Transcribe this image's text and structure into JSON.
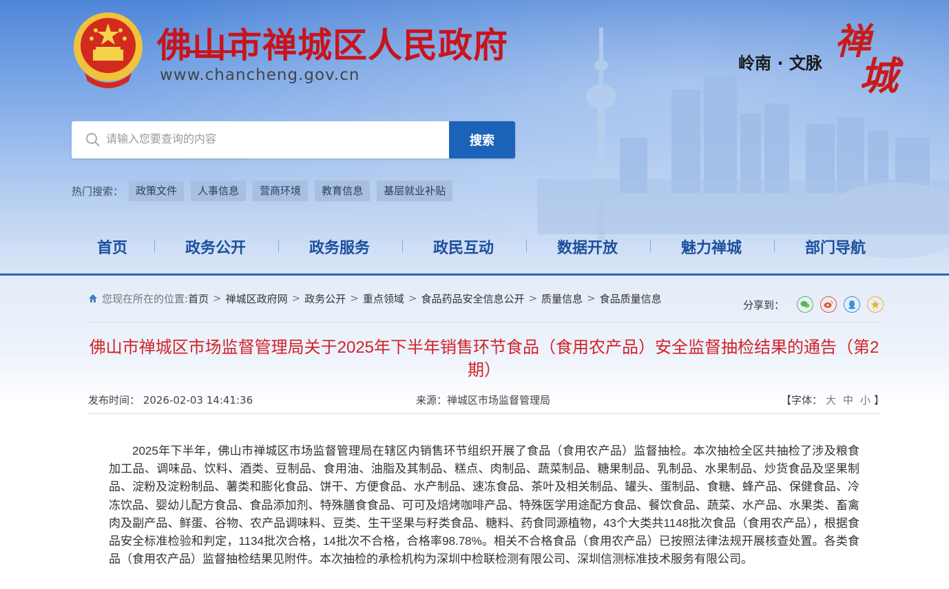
{
  "site": {
    "title": "佛山市禅城区人民政府",
    "url": "www.chancheng.gov.cn",
    "slogan": "岭南 · 文脉",
    "calligraphy": [
      "禅",
      "城"
    ]
  },
  "search": {
    "placeholder": "请输入您要查询的内容",
    "button_label": "搜索",
    "hot_label": "热门搜索：",
    "hot_tags": [
      "政策文件",
      "人事信息",
      "营商环境",
      "教育信息",
      "基层就业补贴"
    ]
  },
  "nav": {
    "items": [
      "首页",
      "政务公开",
      "政务服务",
      "政民互动",
      "数据开放",
      "魅力禅城",
      "部门导航"
    ],
    "active": "政务公开"
  },
  "breadcrumb": {
    "prefix": "您现在所在的位置:",
    "items": [
      "首页",
      "禅城区政府网",
      "政务公开",
      "重点领域",
      "食品药品安全信息公开",
      "质量信息",
      "食品质量信息"
    ]
  },
  "share": {
    "label": "分享到：",
    "icons": [
      "wechat-icon",
      "weibo-icon",
      "qq-icon",
      "qzone-icon"
    ],
    "colors": {
      "wechat": "#5bb84a",
      "weibo": "#e8542f",
      "qq": "#3a8ee6",
      "qzone": "#f0b41c"
    }
  },
  "article": {
    "title": "佛山市禅城区市场监督管理局关于2025年下半年销售环节食品（食用农产品）安全监督抽检结果的通告（第2期）",
    "publish_label": "发布时间：",
    "publish_time": "2026-02-03 14:41:36",
    "source": "来源：禅城区市场监督管理局",
    "font_label": "【字体：",
    "font_options": [
      "大",
      "中",
      "小"
    ],
    "font_close": "】",
    "body": "2025年下半年，佛山市禅城区市场监督管理局在辖区内销售环节组织开展了食品（食用农产品）监督抽检。本次抽检全区共抽检了涉及粮食加工品、调味品、饮料、酒类、豆制品、食用油、油脂及其制品、糕点、肉制品、蔬菜制品、糖果制品、乳制品、水果制品、炒货食品及坚果制品、淀粉及淀粉制品、薯类和膨化食品、饼干、方便食品、水产制品、速冻食品、茶叶及相关制品、罐头、蛋制品、食糖、蜂产品、保健食品、冷冻饮品、婴幼儿配方食品、食品添加剂、特殊膳食食品、可可及焙烤咖啡产品、特殊医学用途配方食品、餐饮食品、蔬菜、水产品、水果类、畜禽肉及副产品、鲜蛋、谷物、农产品调味料、豆类、生干坚果与籽类食品、糖料、药食同源植物，43个大类共1148批次食品（食用农产品），根据食品安全标准检验和判定，1134批次合格，14批次不合格，合格率98.78%。相关不合格食品（食用农产品）已按照法律法规开展核查处置。各类食品（食用农产品）监督抽检结果见附件。本次抽检的承检机构为深圳中检联检测有限公司、深圳信测标准技术服务有限公司。"
  },
  "colors": {
    "brand_red": "#c8141c",
    "nav_blue": "#1d4f9c",
    "search_button": "#1c62b9",
    "title_red": "#d0232a"
  }
}
